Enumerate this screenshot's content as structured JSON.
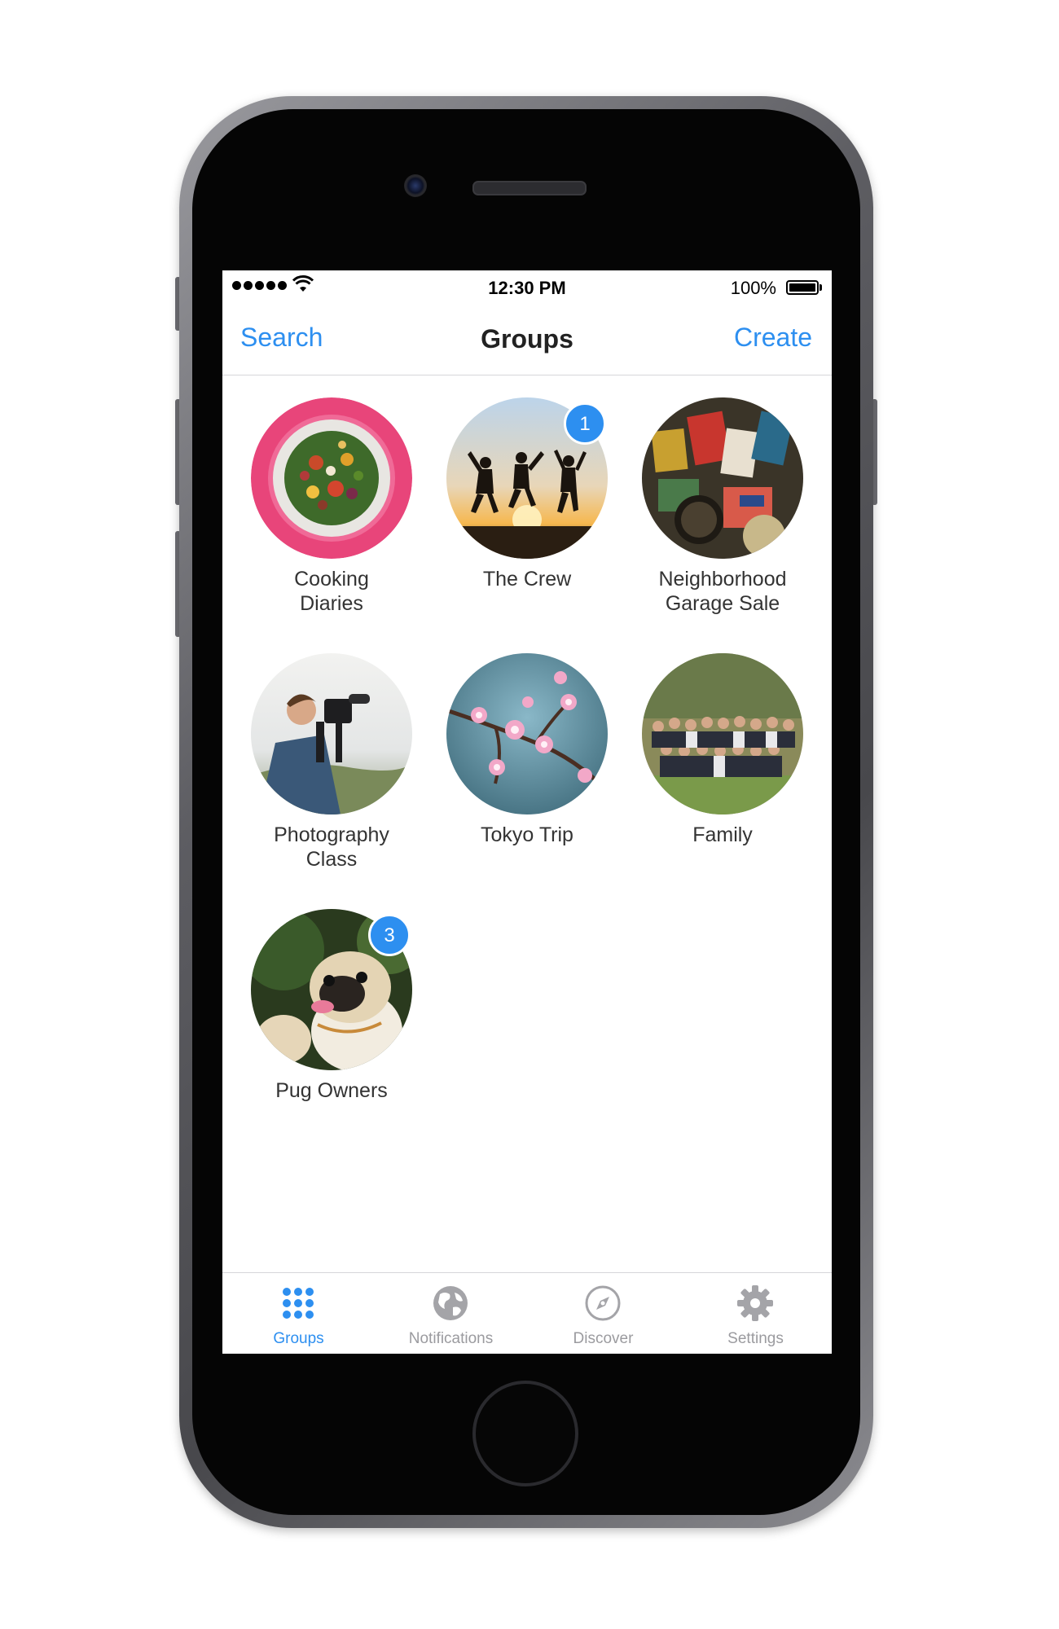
{
  "status_bar": {
    "time": "12:30 PM",
    "battery": "100%"
  },
  "nav": {
    "left": "Search",
    "title": "Groups",
    "right": "Create"
  },
  "groups": [
    {
      "name": "Cooking Diaries",
      "line1": "Cooking",
      "line2": "Diaries",
      "badge": ""
    },
    {
      "name": "The Crew",
      "line1": "The Crew",
      "line2": "",
      "badge": "1"
    },
    {
      "name": "Neighborhood Garage Sale",
      "line1": "Neighborhood",
      "line2": "Garage Sale",
      "badge": ""
    },
    {
      "name": "Photography Class",
      "line1": "Photography",
      "line2": "Class",
      "badge": ""
    },
    {
      "name": "Tokyo Trip",
      "line1": "Tokyo Trip",
      "line2": "",
      "badge": ""
    },
    {
      "name": "Family",
      "line1": "Family",
      "line2": "",
      "badge": ""
    },
    {
      "name": "Pug Owners",
      "line1": "Pug Owners",
      "line2": "",
      "badge": "3"
    }
  ],
  "tabs": [
    {
      "label": "Groups",
      "icon": "grid-dots-icon",
      "active": true
    },
    {
      "label": "Notifications",
      "icon": "globe-icon",
      "active": false
    },
    {
      "label": "Discover",
      "icon": "compass-icon",
      "active": false
    },
    {
      "label": "Settings",
      "icon": "gear-icon",
      "active": false
    }
  ],
  "colors": {
    "accent": "#2d8ff0",
    "tab_inactive": "#9b9b9f"
  }
}
